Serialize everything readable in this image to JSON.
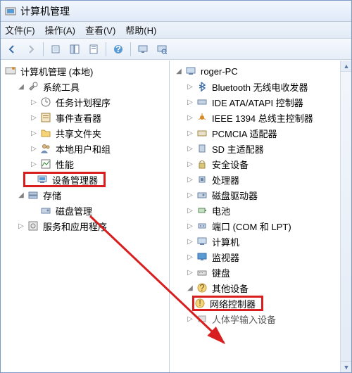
{
  "window": {
    "title": "计算机管理"
  },
  "menubar": {
    "file": "文件(F)",
    "action": "操作(A)",
    "view": "查看(V)",
    "help": "帮助(H)"
  },
  "left_tree": {
    "root": "计算机管理 (本地)",
    "system_tools": "系统工具",
    "task_scheduler": "任务计划程序",
    "event_viewer": "事件查看器",
    "shared_folders": "共享文件夹",
    "local_users_groups": "本地用户和组",
    "performance": "性能",
    "device_manager": "设备管理器",
    "storage": "存储",
    "disk_management": "磁盘管理",
    "services_apps": "服务和应用程序"
  },
  "right_tree": {
    "root": "roger-PC",
    "items": [
      "Bluetooth 无线电收发器",
      "IDE ATA/ATAPI 控制器",
      "IEEE 1394 总线主控制器",
      "PCMCIA 适配器",
      "SD 主适配器",
      "安全设备",
      "处理器",
      "磁盘驱动器",
      "电池",
      "端口 (COM 和 LPT)",
      "计算机",
      "监视器",
      "键盘",
      "其他设备",
      "网络控制器",
      "人体学输入设备"
    ]
  }
}
